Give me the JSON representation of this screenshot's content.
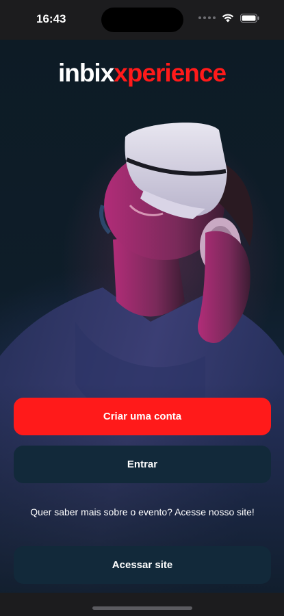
{
  "status_bar": {
    "time": "16:43",
    "icons": [
      "signal-dots-icon",
      "wifi-icon",
      "battery-icon"
    ]
  },
  "brand": {
    "part_white": "inbix",
    "part_red": "xperience",
    "colors": {
      "white": "#ffffff",
      "red": "#ff1a1a"
    }
  },
  "actions": {
    "create_account_label": "Criar uma conta",
    "login_label": "Entrar",
    "visit_site_label": "Acessar site"
  },
  "info": {
    "text": "Quer saber mais sobre o evento? Acesse nosso site!"
  },
  "colors": {
    "primary": "#ff1a1a",
    "secondary_button": "#12293a",
    "background": "#0c1a24"
  }
}
